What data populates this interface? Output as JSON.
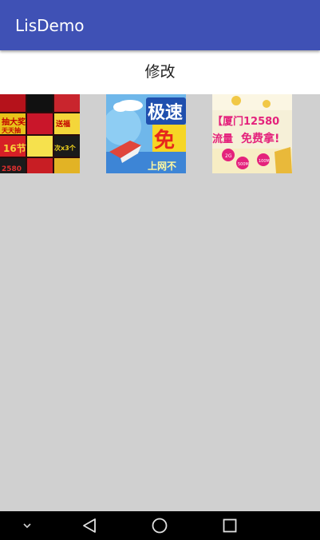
{
  "app_bar": {
    "title": "LisDemo",
    "color": "#3f51b5"
  },
  "edit_bar": {
    "label": "修改"
  },
  "grid": {
    "items": [
      {
        "name": "poster-collage",
        "lines": [
          "抽大奖",
          "天天抽",
          "送福",
          "次x3个",
          "2580",
          "16节"
        ]
      },
      {
        "name": "free-internet-poster",
        "lines": [
          "极速",
          "免",
          "上网不"
        ]
      },
      {
        "name": "xiamen-12580-poster",
        "lines": [
          "【厦门12580",
          "流量",
          "免费拿!",
          "2G",
          "500M",
          "100M"
        ]
      }
    ]
  },
  "nav": {
    "icons": [
      "chevron-down-icon",
      "back-icon",
      "home-icon",
      "recents-icon"
    ]
  }
}
